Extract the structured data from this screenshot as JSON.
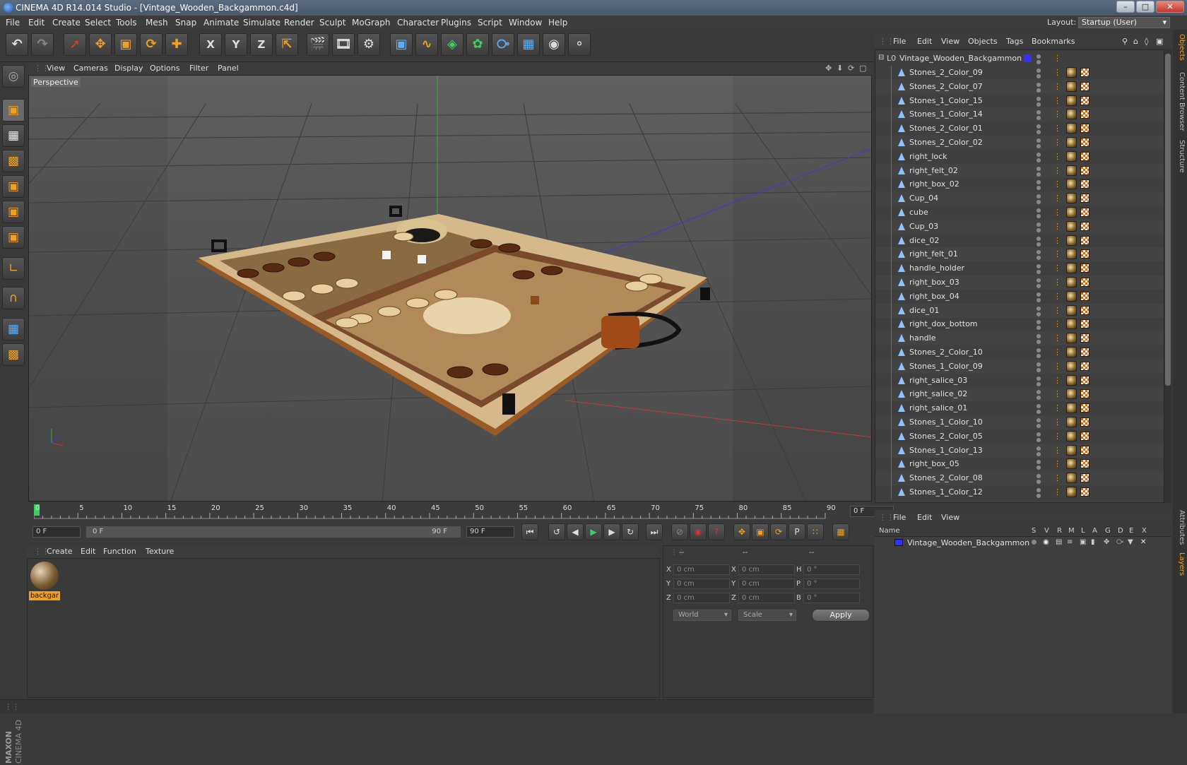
{
  "window": {
    "title": "CINEMA 4D R14.014 Studio - [Vintage_Wooden_Backgammon.c4d]"
  },
  "menubar": {
    "items": [
      "File",
      "Edit",
      "Create",
      "Select",
      "Tools",
      "Mesh",
      "Snap",
      "Animate",
      "Simulate",
      "Render",
      "Sculpt",
      "MoGraph",
      "Character",
      "Plugins",
      "Script",
      "Window",
      "Help"
    ],
    "layout_label": "Layout:",
    "layout_value": "Startup (User)"
  },
  "toolbar": {
    "icons": [
      "undo-icon",
      "redo-icon",
      "live-selection-icon",
      "move-icon",
      "scale-icon",
      "rotate-icon",
      "add-icon",
      "x-axis-icon",
      "y-axis-icon",
      "z-axis-icon",
      "coordinate-system-icon",
      "render-view-icon",
      "render-picture-viewer-icon",
      "edit-render-settings-icon",
      "cube-icon",
      "spline-icon",
      "nurbs-icon",
      "array-icon",
      "deformer-icon",
      "floor-icon",
      "camera-icon",
      "light-icon"
    ],
    "x_label": "X",
    "y_label": "Y",
    "z_label": "Z"
  },
  "viewport": {
    "menu": [
      "View",
      "Cameras",
      "Display",
      "Options",
      "Filter",
      "Panel"
    ],
    "label": "Perspective"
  },
  "timeline": {
    "ticks": [
      "0",
      "5",
      "10",
      "15",
      "20",
      "25",
      "30",
      "35",
      "40",
      "45",
      "50",
      "55",
      "60",
      "65",
      "70",
      "75",
      "80",
      "85",
      "90"
    ],
    "current_frame": "0 F"
  },
  "transport": {
    "start_frame": "0 F",
    "range_start": "0 F",
    "range_end": "90 F",
    "end_frame": "90 F"
  },
  "material_manager": {
    "menu": [
      "Create",
      "Edit",
      "Function",
      "Texture"
    ],
    "materials": [
      {
        "name": "backgar"
      }
    ]
  },
  "coordinates": {
    "header": [
      "--",
      "--",
      "--"
    ],
    "rows": [
      {
        "a_label": "X",
        "a_value": "0 cm",
        "b_label": "X",
        "b_value": "0 cm",
        "c_label": "H",
        "c_value": "0 °"
      },
      {
        "a_label": "Y",
        "a_value": "0 cm",
        "b_label": "Y",
        "b_value": "0 cm",
        "c_label": "P",
        "c_value": "0 °"
      },
      {
        "a_label": "Z",
        "a_value": "0 cm",
        "b_label": "Z",
        "b_value": "0 cm",
        "c_label": "B",
        "c_value": "0 °"
      }
    ],
    "mode_select": "World",
    "transform_select": "Scale",
    "apply_label": "Apply"
  },
  "object_manager": {
    "menu": [
      "File",
      "Edit",
      "View",
      "Objects",
      "Tags",
      "Bookmarks"
    ],
    "root": "Vintage_Wooden_Backgammon",
    "objects": [
      "Stones_2_Color_09",
      "Stones_2_Color_07",
      "Stones_1_Color_15",
      "Stones_1_Color_14",
      "Stones_2_Color_01",
      "Stones_2_Color_02",
      "right_lock",
      "right_felt_02",
      "right_box_02",
      "Cup_04",
      "cube",
      "Cup_03",
      "dice_02",
      "right_felt_01",
      "handle_holder",
      "right_box_03",
      "right_box_04",
      "dice_01",
      "right_dox_bottom",
      "handle",
      "Stones_2_Color_10",
      "Stones_1_Color_09",
      "right_salice_03",
      "right_salice_02",
      "right_salice_01",
      "Stones_1_Color_10",
      "Stones_2_Color_05",
      "Stones_1_Color_13",
      "right_box_05",
      "Stones_2_Color_08",
      "Stones_1_Color_12"
    ]
  },
  "layer_manager": {
    "menu": [
      "File",
      "Edit",
      "View"
    ],
    "columns": [
      "Name",
      "S",
      "V",
      "R",
      "M",
      "L",
      "A",
      "G",
      "D",
      "E",
      "X"
    ],
    "layers": [
      {
        "name": "Vintage_Wooden_Backgammon",
        "color": "#3030ff"
      }
    ]
  },
  "side_tabs": [
    "Objects",
    "Content Browser",
    "Structure",
    "Attributes",
    "Layers"
  ],
  "branding": {
    "vendor": "MAXON",
    "product": "CINEMA 4D"
  },
  "colors": {
    "accent": "#f0a020",
    "background": "#3a3a3a",
    "viewport_bg": "#4d4d4d"
  }
}
